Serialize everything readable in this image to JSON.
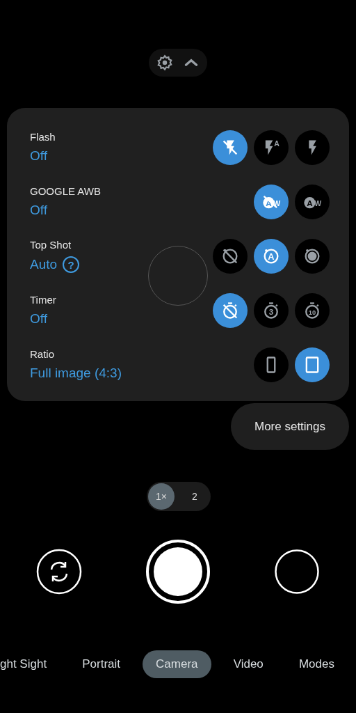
{
  "settings": [
    {
      "label": "Flash",
      "value": "Off",
      "options": [
        {
          "kind": "flash-off",
          "selected": true
        },
        {
          "kind": "flash-auto",
          "glyph": "A",
          "selected": false
        },
        {
          "kind": "flash-on",
          "selected": false
        }
      ]
    },
    {
      "label": "GOOGLE AWB",
      "value": "Off",
      "options": [
        {
          "kind": "awb-off",
          "glyph": "AW",
          "selected": true
        },
        {
          "kind": "awb-on",
          "glyph": "AW",
          "selected": false
        }
      ]
    },
    {
      "label": "Top Shot",
      "value": "Auto",
      "help": "?",
      "options": [
        {
          "kind": "topshot-off",
          "selected": false
        },
        {
          "kind": "topshot-auto",
          "glyph": "A",
          "selected": true
        },
        {
          "kind": "topshot-on",
          "selected": false
        }
      ]
    },
    {
      "label": "Timer",
      "value": "Off",
      "options": [
        {
          "kind": "timer-off",
          "selected": true
        },
        {
          "kind": "timer-3",
          "glyph": "3",
          "selected": false
        },
        {
          "kind": "timer-10",
          "glyph": "10",
          "selected": false
        }
      ]
    },
    {
      "label": "Ratio",
      "value": "Full image (4:3)",
      "options": [
        {
          "kind": "ratio-tall",
          "selected": false
        },
        {
          "kind": "ratio-full",
          "selected": true
        }
      ]
    }
  ],
  "more_settings": "More settings",
  "zoom": [
    {
      "label": "1×",
      "selected": true
    },
    {
      "label": "2",
      "selected": false
    }
  ],
  "modes": [
    {
      "label": "ght Sight",
      "selected": false
    },
    {
      "label": "Portrait",
      "selected": false
    },
    {
      "label": "Camera",
      "selected": true
    },
    {
      "label": "Video",
      "selected": false
    },
    {
      "label": "Modes",
      "selected": false
    }
  ]
}
